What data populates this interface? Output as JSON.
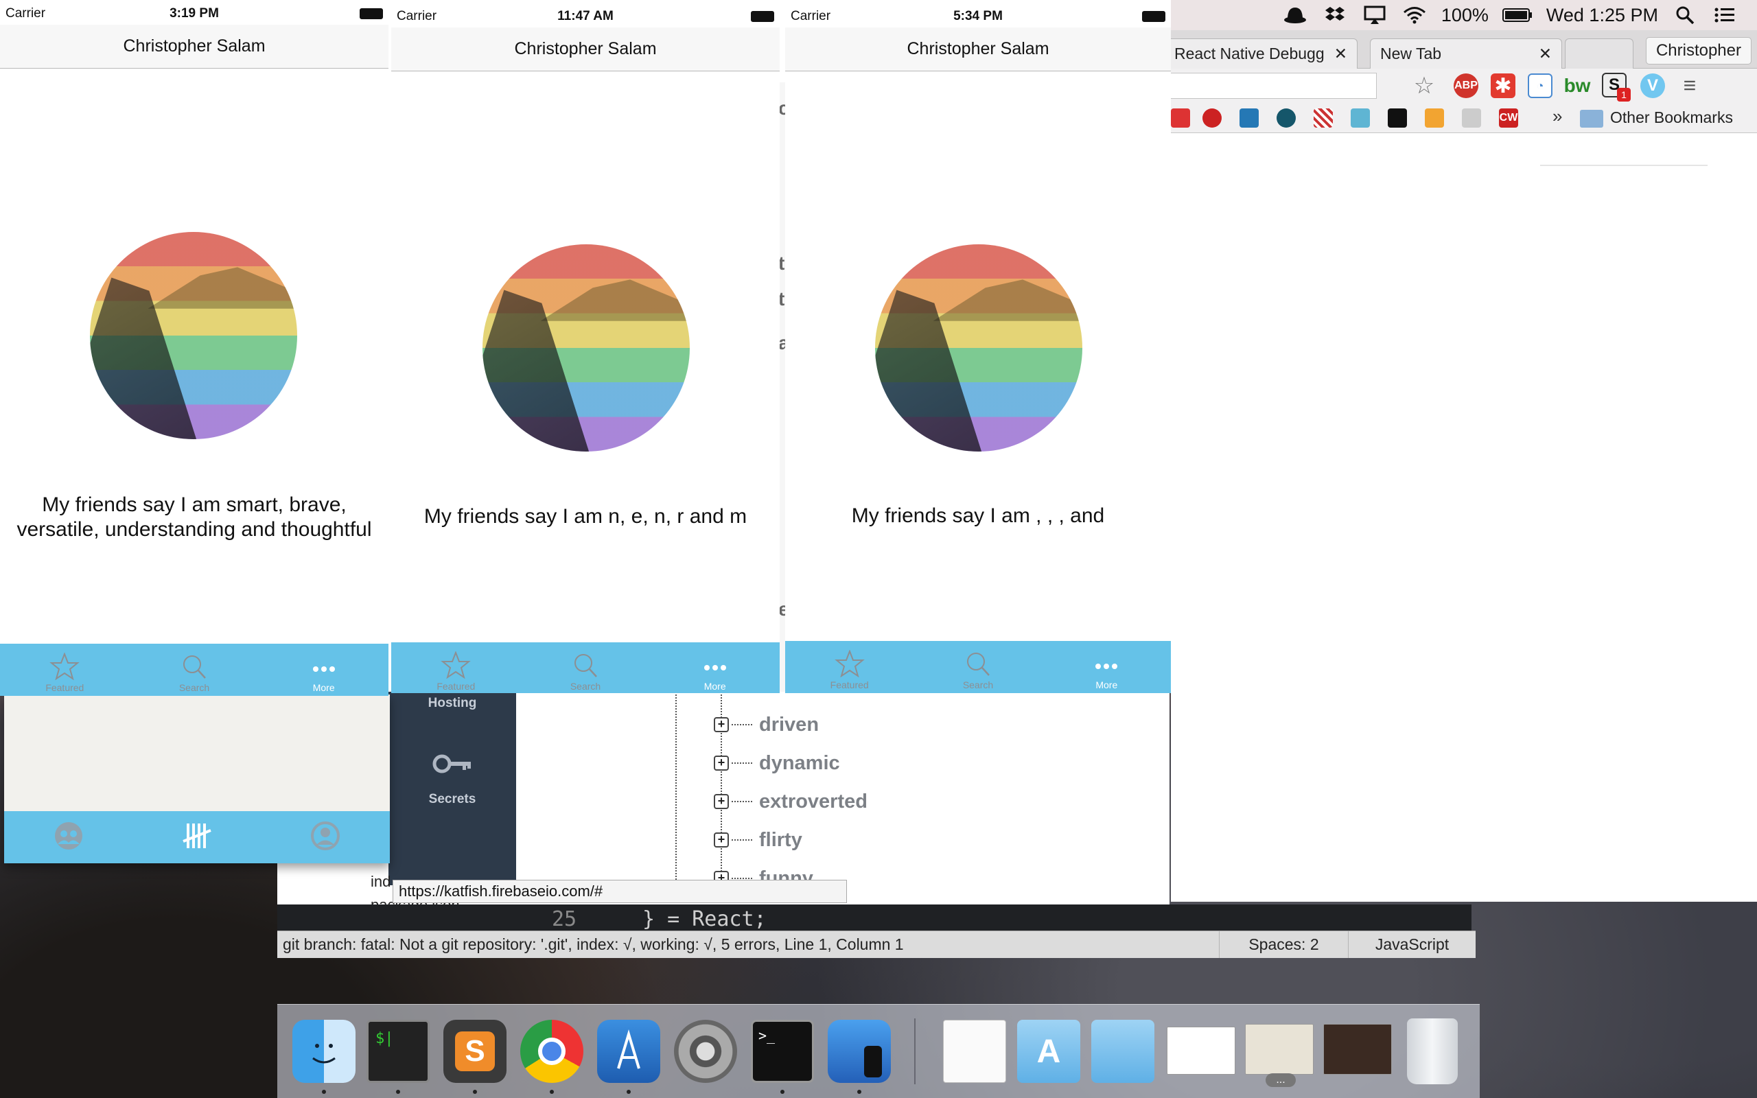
{
  "menubar": {
    "battery_percent": "100%",
    "datetime": "Wed 1:25 PM",
    "icons": [
      "bowler-hat-icon",
      "dropbox-icon",
      "airplay-icon",
      "wifi-icon",
      "battery-icon",
      "spotlight-icon",
      "notification-center-icon"
    ]
  },
  "chrome": {
    "tabs": [
      {
        "label": "React Native Debugg"
      },
      {
        "label": "New Tab"
      }
    ],
    "profile_name": "Christopher",
    "extensions": [
      "ABP",
      "bw",
      "S"
    ],
    "extension_badge": "1",
    "other_bookmarks": "Other Bookmarks",
    "bookmarks_overflow": "»",
    "bookmark_labels": [
      "CW"
    ],
    "colors": {
      "accent": "#65c2e8"
    }
  },
  "simulators": [
    {
      "carrier": "Carrier",
      "time": "3:19 PM",
      "title": "Christopher Salam",
      "quote": "My friends say I am smart, brave, versatile, understanding and thoughtful"
    },
    {
      "carrier": "Carrier",
      "time": "11:47 AM",
      "title": "Christopher Salam",
      "quote": "My friends say I am n, e, n, r and m"
    },
    {
      "carrier": "Carrier",
      "time": "5:34 PM",
      "title": "Christopher Salam",
      "quote": "My friends say I am , , ,  and"
    }
  ],
  "tabbar": {
    "items": [
      {
        "label": "Featured",
        "icon": "star-icon"
      },
      {
        "label": "Search",
        "icon": "search-icon"
      },
      {
        "label": "More",
        "icon": "more-icon"
      }
    ],
    "selected": "More"
  },
  "lower_tabbar_icons": [
    "group-icon",
    "tally-icon",
    "profile-icon"
  ],
  "firebase": {
    "sidebar": [
      {
        "label": "Hosting"
      },
      {
        "label": "Secrets"
      }
    ],
    "tree_nodes": [
      "driven",
      "dynamic",
      "extroverted",
      "flirty",
      "funny"
    ],
    "url_tooltip": "https://katfish.firebaseio.com/#"
  },
  "editor": {
    "files": [
      "ind",
      "package.json"
    ],
    "line_number": "25",
    "code_line": "} = React;",
    "status_text": "git branch: fatal: Not a git repository: '.git', index: √, working: √, 5 errors, Line 1, Column 1",
    "spaces": "Spaces: 2",
    "syntax": "JavaScript",
    "slice_letters": [
      "c",
      "t",
      "t",
      "a",
      "e"
    ]
  },
  "dock": {
    "apps": [
      "finder-icon",
      "iterm-icon",
      "sublime-text-icon",
      "chrome-icon",
      "xcode-icon",
      "system-preferences-icon",
      "terminal-icon",
      "ios-simulator-icon",
      "document-icon",
      "applications-folder-icon",
      "folder-icon",
      "window-thumbnail-icon",
      "window-thumbnail-icon",
      "window-thumbnail-icon",
      "trash-icon"
    ],
    "overflow": "..."
  }
}
